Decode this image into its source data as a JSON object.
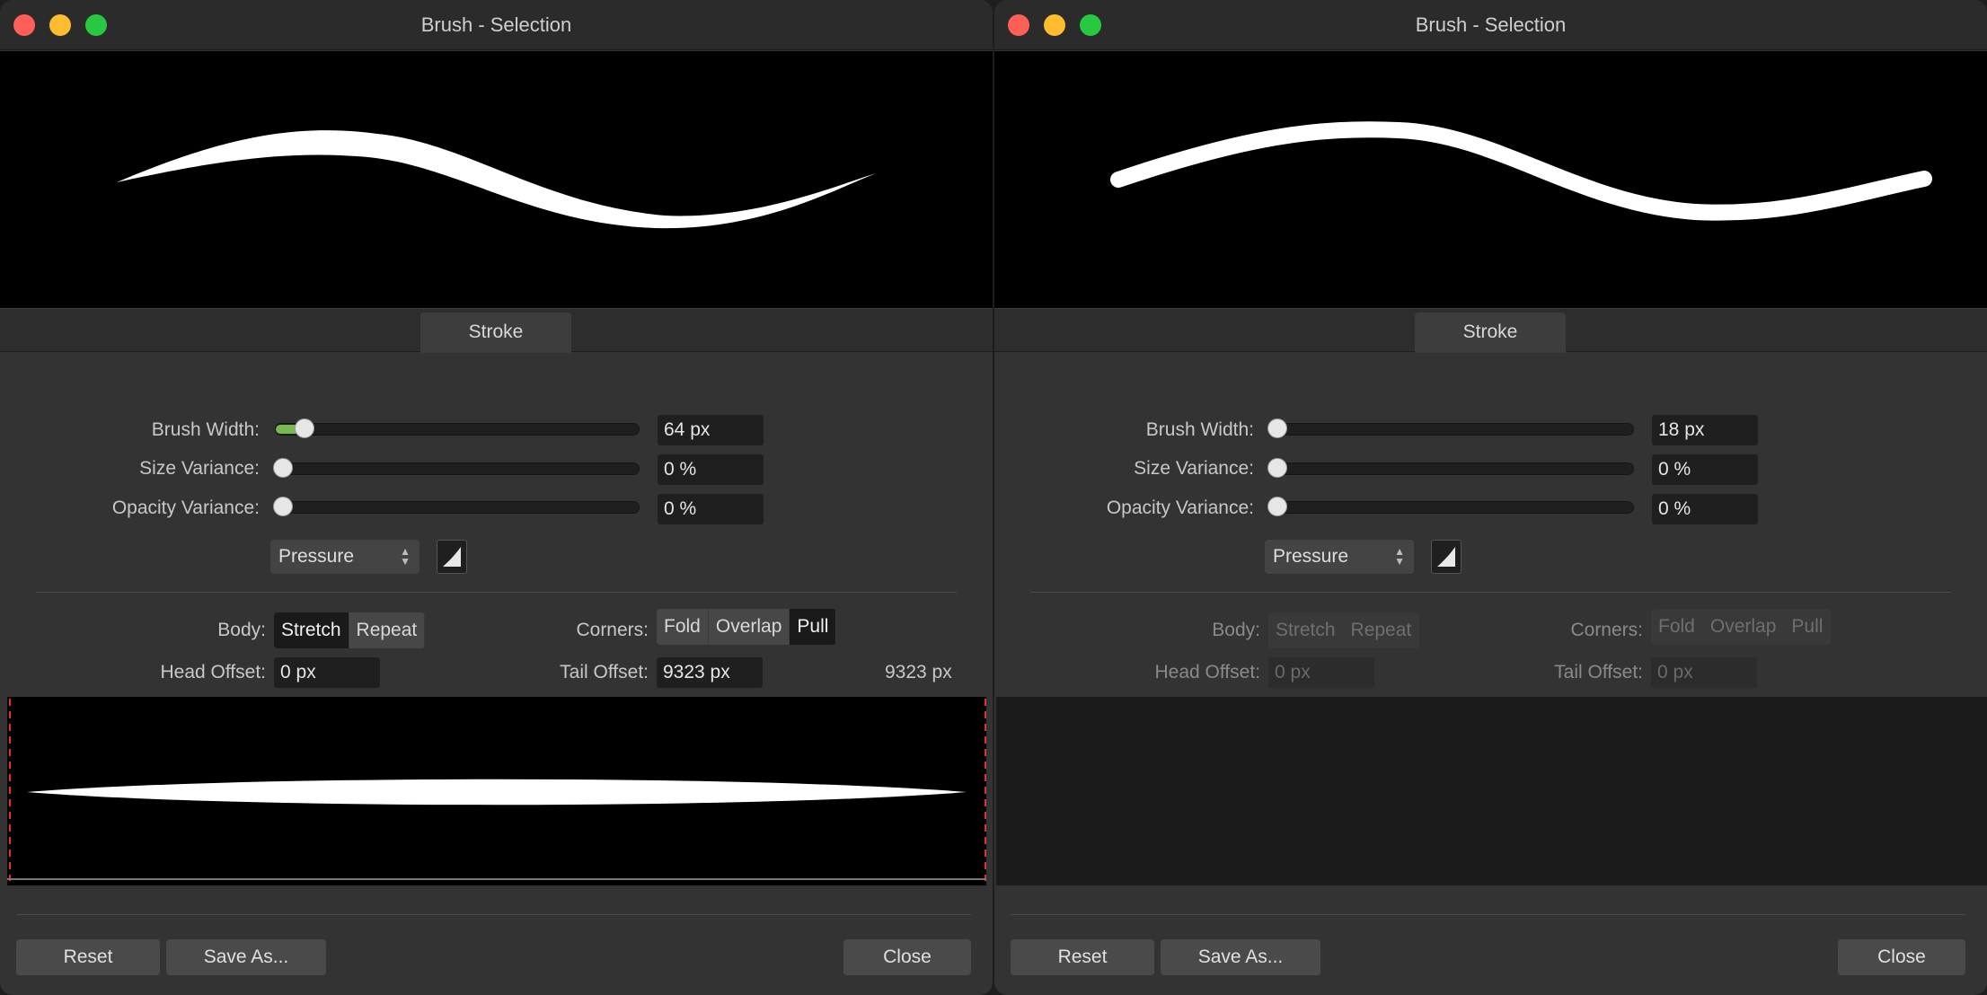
{
  "windows": [
    {
      "title": "Brush - Selection",
      "tab_label": "Stroke",
      "brush_width": {
        "label": "Brush Width:",
        "value": "64 px",
        "level": 0.08
      },
      "size_variance": {
        "label": "Size Variance:",
        "value": "0 %",
        "level": 0
      },
      "opacity_variance": {
        "label": "Opacity Variance:",
        "value": "0 %",
        "level": 0
      },
      "controller": {
        "selected": "Pressure"
      },
      "body": {
        "label": "Body:",
        "options": [
          "Stretch",
          "Repeat"
        ],
        "selected": "Stretch"
      },
      "corners": {
        "label": "Corners:",
        "options": [
          "Fold",
          "Overlap",
          "Pull"
        ],
        "selected": "Pull"
      },
      "head_offset": {
        "label": "Head Offset:",
        "value": "0 px"
      },
      "tail_offset": {
        "label": "Tail Offset:",
        "value": "9323 px"
      },
      "nozzle_length": "9323 px",
      "buttons": {
        "reset": "Reset",
        "save_as": "Save As...",
        "close": "Close"
      }
    },
    {
      "title": "Brush - Selection",
      "tab_label": "Stroke",
      "brush_width": {
        "label": "Brush Width:",
        "value": "18 px",
        "level": 0
      },
      "size_variance": {
        "label": "Size Variance:",
        "value": "0 %",
        "level": 0
      },
      "opacity_variance": {
        "label": "Opacity Variance:",
        "value": "0 %",
        "level": 0
      },
      "controller": {
        "selected": "Pressure"
      },
      "body": {
        "label": "Body:",
        "options": [
          "Stretch",
          "Repeat"
        ],
        "selected": ""
      },
      "corners": {
        "label": "Corners:",
        "options": [
          "Fold",
          "Overlap",
          "Pull"
        ],
        "selected": ""
      },
      "head_offset": {
        "label": "Head Offset:",
        "value": "0 px"
      },
      "tail_offset": {
        "label": "Tail Offset:",
        "value": "0 px"
      },
      "buttons": {
        "reset": "Reset",
        "save_as": "Save As...",
        "close": "Close"
      }
    }
  ],
  "colors": {
    "close": "#ff5f57",
    "minimize": "#febc2e",
    "maximize": "#28c840",
    "slider_accent": "#78b852",
    "guide_line": "#e03030"
  }
}
